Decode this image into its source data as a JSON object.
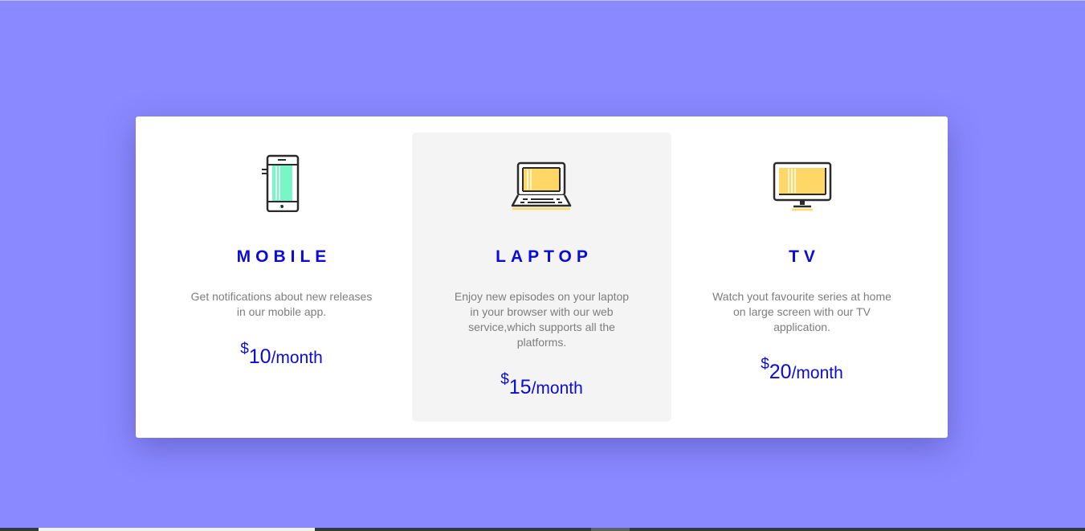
{
  "plans": [
    {
      "title": "MOBILE",
      "icon": "mobile-phone-icon",
      "description": "Get notifications about new releases in our mobile app.",
      "currency": "$",
      "amount": "10",
      "period": "/month"
    },
    {
      "title": "LAPTOP",
      "icon": "laptop-icon",
      "description": "Enjoy new episodes on your laptop in your browser with our web service,which supports all the platforms.",
      "currency": "$",
      "amount": "15",
      "period": "/month"
    },
    {
      "title": "TV",
      "icon": "tv-icon",
      "description": "Watch yout favourite series at home on large screen with our TV application.",
      "currency": "$",
      "amount": "20",
      "period": "/month"
    }
  ],
  "colors": {
    "background": "#8b89ff",
    "accent": "#0b0bd8",
    "mobile_screen": "#7af5c8",
    "screen_yellow": "#ffd766",
    "highlight_bg": "#f4f4f4"
  }
}
